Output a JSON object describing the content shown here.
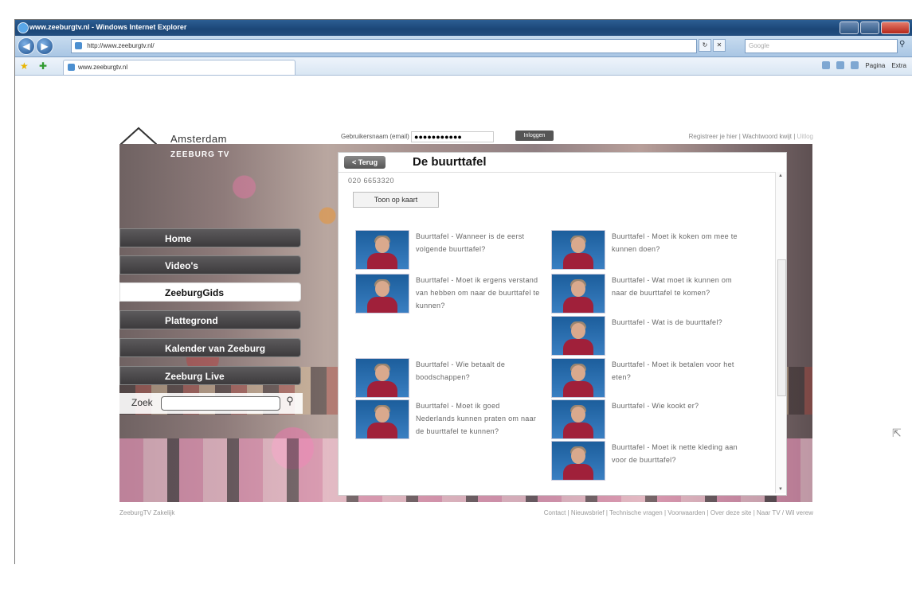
{
  "browser": {
    "window_title": "www.zeeburgtv.nl - Windows Internet Explorer",
    "address": "http://www.zeeburgtv.nl/",
    "search_placeholder": "Google",
    "tab_title": "www.zeeburgtv.nl",
    "command_bar": {
      "page_label": "Pagina",
      "extra_label": "Extra"
    }
  },
  "site": {
    "logo_city": "Amsterdam",
    "logo_brand": "ZEEBURG TV",
    "login": {
      "username_label": "Gebruikersnaam (email)",
      "password_value": "●●●●●●●●●●●",
      "login_button": "Inloggen"
    },
    "top_links": {
      "register": "Registreer je hier",
      "forgot": "Wachtwoord kwijt",
      "logout": "Uitlog"
    },
    "menu": [
      {
        "label": "Home",
        "active": false
      },
      {
        "label": "Video's",
        "active": false
      },
      {
        "label": "ZeeburgGids",
        "active": true
      },
      {
        "label": "Plattegrond",
        "active": false
      },
      {
        "label": "Kalender van Zeeburg",
        "active": false
      },
      {
        "label": "Zeeburg Live",
        "active": false
      }
    ],
    "search_label": "Zoek"
  },
  "panel": {
    "back_button": "< Terug",
    "title": "De buurttafel",
    "phone": "020 6653320",
    "map_button": "Toon op kaart",
    "videos_left": [
      "Buurttafel - Wanneer is de eerst volgende buurttafel?",
      "Buurttafel - Moet ik ergens verstand van hebben om naar de buurttafel te kunnen?",
      "Buurttafel - Wie betaalt de boodschappen?",
      "Buurttafel - Moet ik goed Nederlands kunnen praten om naar de buurttafel te kunnen?"
    ],
    "videos_right": [
      "Buurttafel - Moet ik koken om mee te kunnen doen?",
      "Buurttafel - Wat moet ik kunnen om naar de buurttafel te komen?",
      "Buurttafel - Wat is de buurttafel?",
      "Buurttafel - Moet ik betalen voor het eten?",
      "Buurttafel - Wie kookt er?",
      "Buurttafel - Moet ik nette kleding aan voor de buurttafel?"
    ]
  },
  "footer": {
    "left": "ZeeburgTV Zakelijk",
    "right": "Contact | Nieuwsbrief | Technische vragen | Voorwaarden | Over deze site | Naar TV / Wil verew"
  }
}
